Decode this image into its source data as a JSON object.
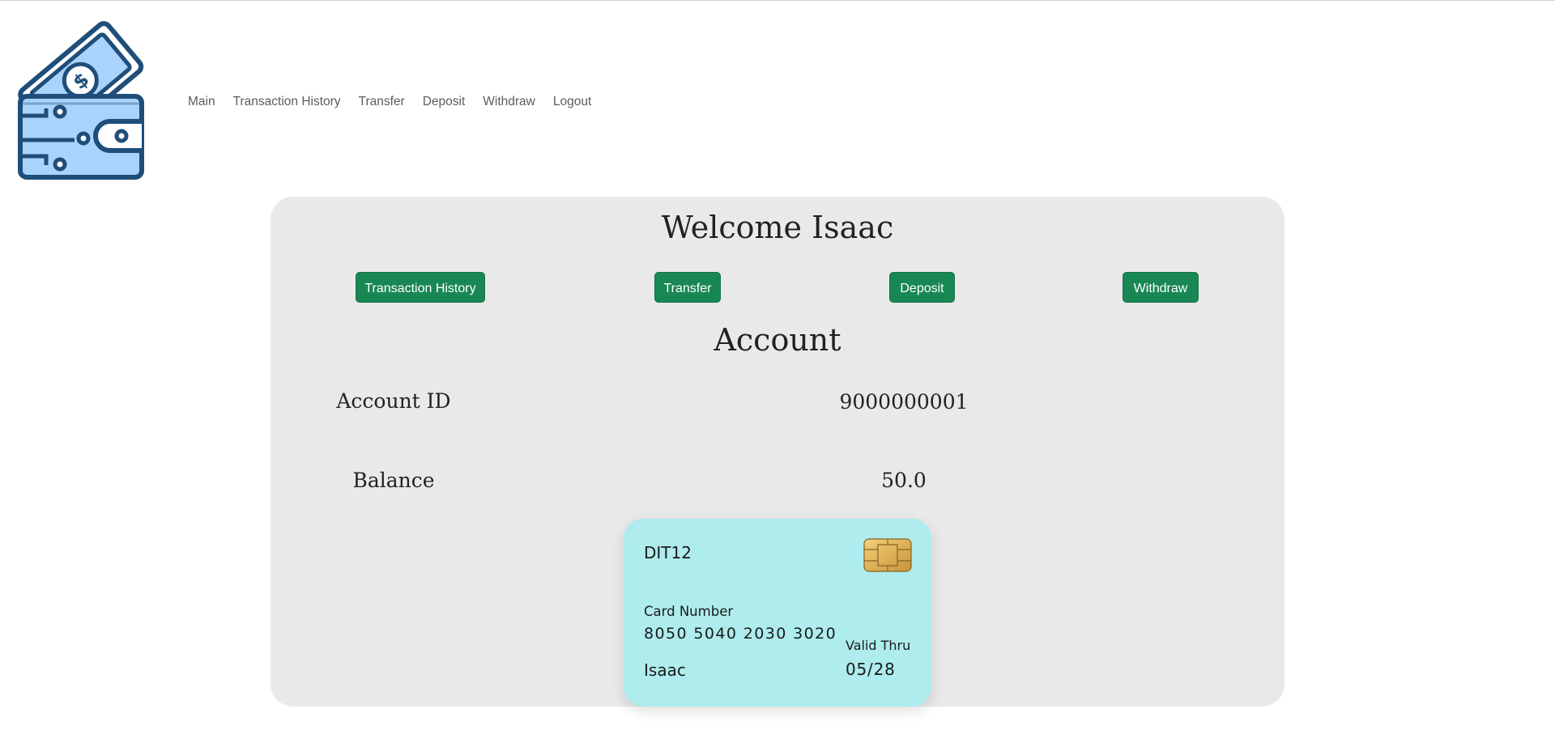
{
  "brand": {
    "icon": "wallet-money-icon"
  },
  "nav": {
    "items": [
      {
        "label": "Main"
      },
      {
        "label": "Transaction History"
      },
      {
        "label": "Transfer"
      },
      {
        "label": "Deposit"
      },
      {
        "label": "Withdraw"
      },
      {
        "label": "Logout"
      }
    ]
  },
  "dashboard": {
    "welcome": "Welcome Isaac",
    "buttons": {
      "transaction_history": "Transaction History",
      "transfer": "Transfer",
      "deposit": "Deposit",
      "withdraw": "Withdraw"
    },
    "account_title": "Account",
    "account_id_label": "Account ID",
    "account_id_value": "9000000001",
    "balance_label": "Balance",
    "balance_value": "50.0"
  },
  "card": {
    "bank": "DIT12",
    "number_label": "Card Number",
    "number": "8050 5040 2030 3020",
    "holder": "Isaac",
    "valid_label": "Valid Thru",
    "valid": "05/28",
    "chip_icon": "card-chip-icon"
  },
  "colors": {
    "button_bg": "#198754",
    "panel_bg": "#e9e9e9",
    "card_bg": "#aeeced",
    "icon_stroke": "#1f4e7a",
    "icon_fill": "#a9d3fb"
  }
}
